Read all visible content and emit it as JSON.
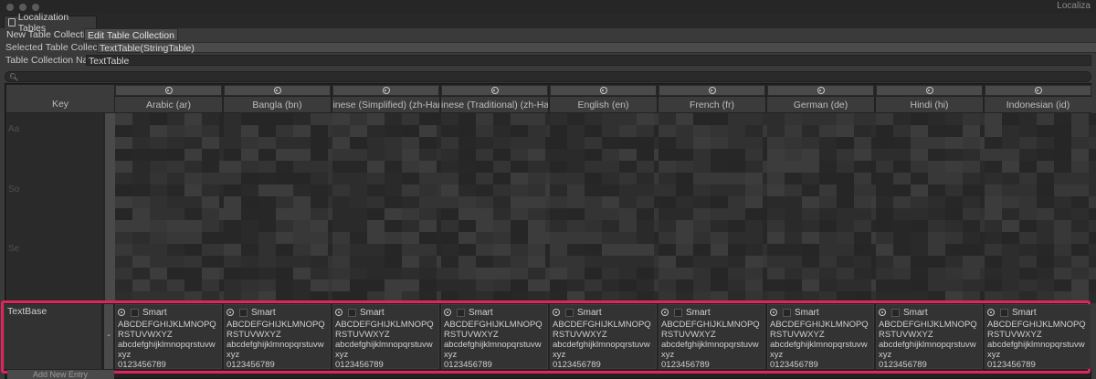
{
  "window": {
    "title": "Localiza"
  },
  "tab": {
    "label": "Localization Tables"
  },
  "toolbar": {
    "new_collection": "New Table Collection",
    "edit_collection": "Edit Table Collection"
  },
  "selected_collection": {
    "label": "Selected Table Collection",
    "value": "TextTable(StringTable)"
  },
  "collection_name": {
    "label": "Table Collection Name",
    "value": "TextTable"
  },
  "table": {
    "key_header": "Key",
    "columns": [
      {
        "name": "Arabic (ar)"
      },
      {
        "name": "Bangla (bn)"
      },
      {
        "name": "Chinese (Simplified) (zh-Hans)"
      },
      {
        "name": "Chinese (Traditional) (zh-Hant)"
      },
      {
        "name": "English (en)"
      },
      {
        "name": "French (fr)"
      },
      {
        "name": "German (de)"
      },
      {
        "name": "Hindi (hi)"
      },
      {
        "name": "Indonesian (id)"
      }
    ],
    "blurred_keys": [
      "Aa",
      "So",
      "Se"
    ],
    "row": {
      "key": "TextBase",
      "remove": "-",
      "smart_label": "Smart",
      "values": [
        "ABCDEFGHIJKLMNOPQRSTUVWXYZ\nabcdefghijklmnopqrstuvwxyz\n0123456789",
        "ABCDEFGHIJKLMNOPQRSTUVWXYZ\nabcdefghijklmnopqrstuvwxyz\n0123456789",
        "ABCDEFGHIJKLMNOPQRSTUVWXYZ\nabcdefghijklmnopqrstuvwxyz\n0123456789",
        "ABCDEFGHIJKLMNOPQRSTUVWXYZ\nabcdefghijklmnopqrstuvwxyz\n0123456789",
        "ABCDEFGHIJKLMNOPQRSTUVWXYZ\nabcdefghijklmnopqrstuvwxyz\n0123456789",
        "ABCDEFGHIJKLMNOPQRSTUVWXYZ\nabcdefghijklmnopqrstuvwxyz\n0123456789",
        "ABCDEFGHIJKLMNOPQRSTUVWXYZ\nabcdefghijklmnopqrstuvwxyz\n0123456789",
        "ABCDEFGHIJKLMNOPQRSTUVWXYZ\nabcdefghijklmnopqrstuvwxyz\n0123456789",
        "ABCDEFGHIJKLMNOPQRSTUVWXYZ\nabcdefghijklmnopqrstuvwxyz\n0123456789"
      ]
    },
    "add_entry": "Add New Entry"
  },
  "colors": {
    "highlight": "#e0245e",
    "background": "#3a3a3a"
  },
  "icons": {
    "tab_icon": "localization-table-icon",
    "column_icon": "gear-icon",
    "search_icon": "search-icon"
  }
}
